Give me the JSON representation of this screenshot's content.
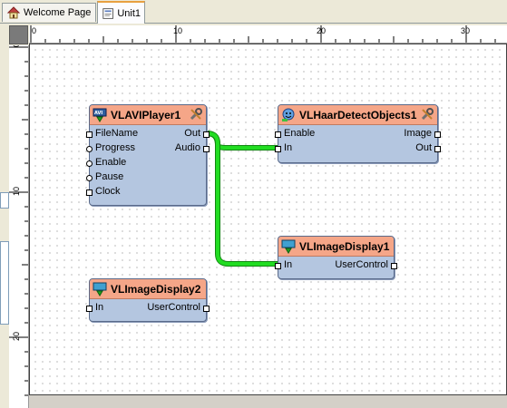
{
  "tabs": [
    {
      "label": "Welcome Page",
      "icon": "home-icon"
    },
    {
      "label": "Unit1",
      "icon": "unit-icon"
    }
  ],
  "ruler": {
    "h_labels": [
      "0",
      "10",
      "20",
      "30"
    ],
    "v_labels": [
      "0",
      "10",
      "20"
    ]
  },
  "components": {
    "aviplayer": {
      "name": "VLAVIPlayer1",
      "inputs": [
        "FileName",
        "Progress",
        "Enable",
        "Pause",
        "Clock"
      ],
      "outputs": [
        "Out",
        "Audio"
      ]
    },
    "haar": {
      "name": "VLHaarDetectObjects1",
      "inputs": [
        "Enable",
        "In"
      ],
      "outputs": [
        "Image",
        "Out"
      ]
    },
    "display1": {
      "name": "VLImageDisplay1",
      "inputs": [
        "In"
      ],
      "outputs": [
        "UserControl"
      ]
    },
    "display2": {
      "name": "VLImageDisplay2",
      "inputs": [
        "In"
      ],
      "outputs": [
        "UserControl"
      ]
    }
  },
  "colors": {
    "header": "#f5a688",
    "body": "#b4c6e0",
    "wire": "#22dd22",
    "tab_highlight": "#e8a040"
  }
}
